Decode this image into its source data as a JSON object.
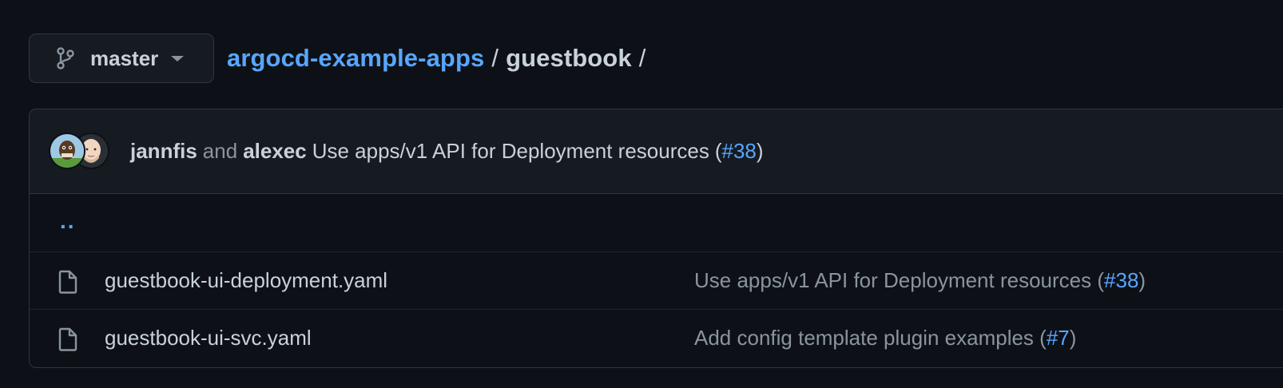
{
  "branch": {
    "name": "master",
    "icon": "git-branch-icon"
  },
  "breadcrumb": {
    "repo": "argocd-example-apps",
    "separator": "/",
    "folder": "guestbook",
    "trailing": "/"
  },
  "latest_commit": {
    "author1": "jannfis",
    "connector": "and",
    "author2": "alexec",
    "message": "Use apps/v1 API for Deployment resources",
    "open_paren": "(",
    "pr": "#38",
    "close_paren": ")"
  },
  "parent_dir": "..",
  "files": [
    {
      "name": "guestbook-ui-deployment.yaml",
      "commit_message": "Use apps/v1 API for Deployment resources",
      "open_paren": "(",
      "pr": "#38",
      "close_paren": ")"
    },
    {
      "name": "guestbook-ui-svc.yaml",
      "commit_message": "Add config template plugin examples",
      "open_paren": "(",
      "pr": "#7",
      "close_paren": ")"
    }
  ],
  "colors": {
    "background": "#0d1117",
    "header": "#161b22",
    "border": "#30363d",
    "link": "#58a6ff",
    "text": "#c9d1d9",
    "muted": "#8b949e"
  }
}
